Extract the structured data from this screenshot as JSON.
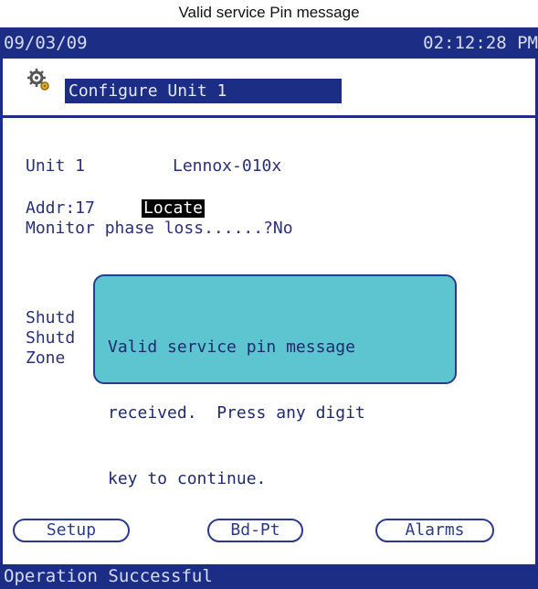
{
  "caption": "Valid service Pin message",
  "topbar": {
    "date": "09/03/09",
    "time": "02:12:28 PM"
  },
  "header": {
    "title": "Configure Unit 1",
    "icon": "gear-icon"
  },
  "content": {
    "unit_label": "Unit 1",
    "unit_model": "Lennox-010x",
    "addr_label": "Addr:17",
    "locate_label": "Locate",
    "monitor_line": "Monitor phase loss......?No",
    "partial_1": "Shutd",
    "partial_2": "Shutd",
    "partial_3": "Zone"
  },
  "popup": {
    "line1": "Valid service pin message",
    "line2": "received.  Press any digit",
    "line3": "key to continue."
  },
  "buttons": {
    "setup": "Setup",
    "bdpt": "Bd-Pt",
    "alarms": "Alarms"
  },
  "status": {
    "text": "Operation Successful"
  },
  "colors": {
    "bar": "#1b2d84",
    "popup": "#5cc5d0",
    "text": "#2a2f7a",
    "highlight": "#000000"
  }
}
